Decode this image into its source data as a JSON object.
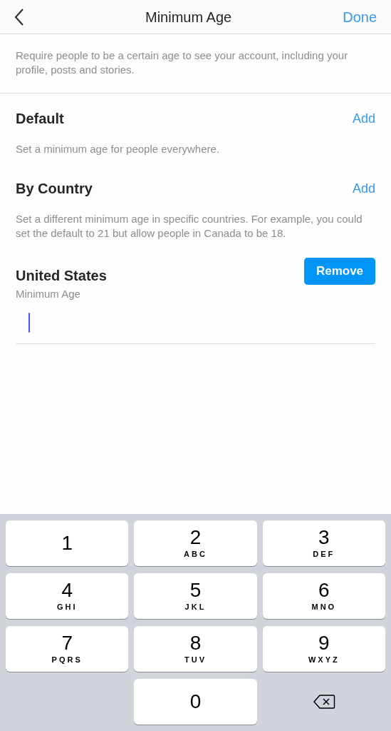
{
  "header": {
    "title": "Minimum Age",
    "done": "Done"
  },
  "description": "Require people to be a certain age to see your account, including your profile, posts and stories.",
  "sections": [
    {
      "title": "Default",
      "action": "Add",
      "note": "Set a minimum age for people everywhere."
    },
    {
      "title": "By Country",
      "action": "Add",
      "note": "Set a different minimum age in specific countries. For example, you could set the default to 21 but allow people in Canada to be 18."
    }
  ],
  "country": {
    "name": "United States",
    "label": "Minimum Age",
    "remove": "Remove",
    "focused": true
  },
  "keypad": [
    {
      "kind": "digit",
      "digit": "1"
    },
    {
      "kind": "digit",
      "digit": "2",
      "letters": "ABC"
    },
    {
      "kind": "digit",
      "digit": "3",
      "letters": "DEF"
    },
    {
      "kind": "digit",
      "digit": "4",
      "letters": "GHI"
    },
    {
      "kind": "digit",
      "digit": "5",
      "letters": "JKL"
    },
    {
      "kind": "digit",
      "digit": "6",
      "letters": "MNO"
    },
    {
      "kind": "digit",
      "digit": "7",
      "letters": "PQRS"
    },
    {
      "kind": "digit",
      "digit": "8",
      "letters": "TUV"
    },
    {
      "kind": "digit",
      "digit": "9",
      "letters": "WXYZ"
    },
    {
      "kind": "empty"
    },
    {
      "kind": "digit",
      "digit": "0"
    },
    {
      "kind": "delete"
    }
  ]
}
